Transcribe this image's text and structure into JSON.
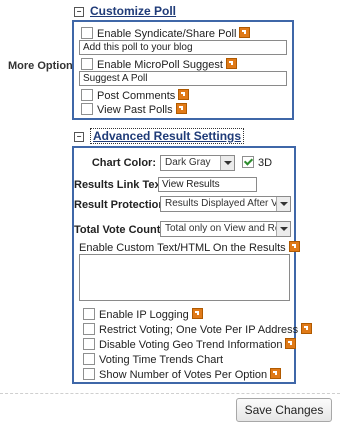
{
  "customize_poll": {
    "header": "Customize Poll",
    "more_options_label": "More Options:",
    "items": [
      {
        "label": "Enable Syndicate/Share Poll",
        "checked": false
      },
      {
        "label": "Enable MicroPoll Suggest",
        "checked": false
      },
      {
        "label": "Post Comments",
        "checked": false
      },
      {
        "label": "View Past Polls",
        "checked": false
      }
    ],
    "syndicate_text": "Add this poll to your blog",
    "micropoll_text": "Suggest A Poll"
  },
  "advanced": {
    "header": "Advanced Result Settings",
    "chart_color_label": "Chart Color:",
    "chart_color_value": "Dark Gray",
    "three_d_label": "3D",
    "three_d_checked": true,
    "results_link_label": "Results Link Text:",
    "results_link_value": "View Results",
    "results_protection_label": "Result Protection:",
    "results_protection_value": "Results Displayed After Voting",
    "total_vote_label": "Total Vote Count:",
    "total_vote_value": "Total only on View and Results",
    "custom_html_label": "Enable Custom Text/HTML On the Results",
    "options": [
      {
        "label": "Enable IP Logging",
        "checked": false
      },
      {
        "label": "Restrict Voting; One Vote Per IP Address",
        "checked": false
      },
      {
        "label": "Disable Voting Geo Trend Information",
        "checked": false
      },
      {
        "label": "Voting Time Trends Chart",
        "checked": false
      },
      {
        "label": "Show Number of Votes Per Option",
        "checked": false
      }
    ]
  },
  "footer": {
    "save_label": "Save Changes"
  }
}
